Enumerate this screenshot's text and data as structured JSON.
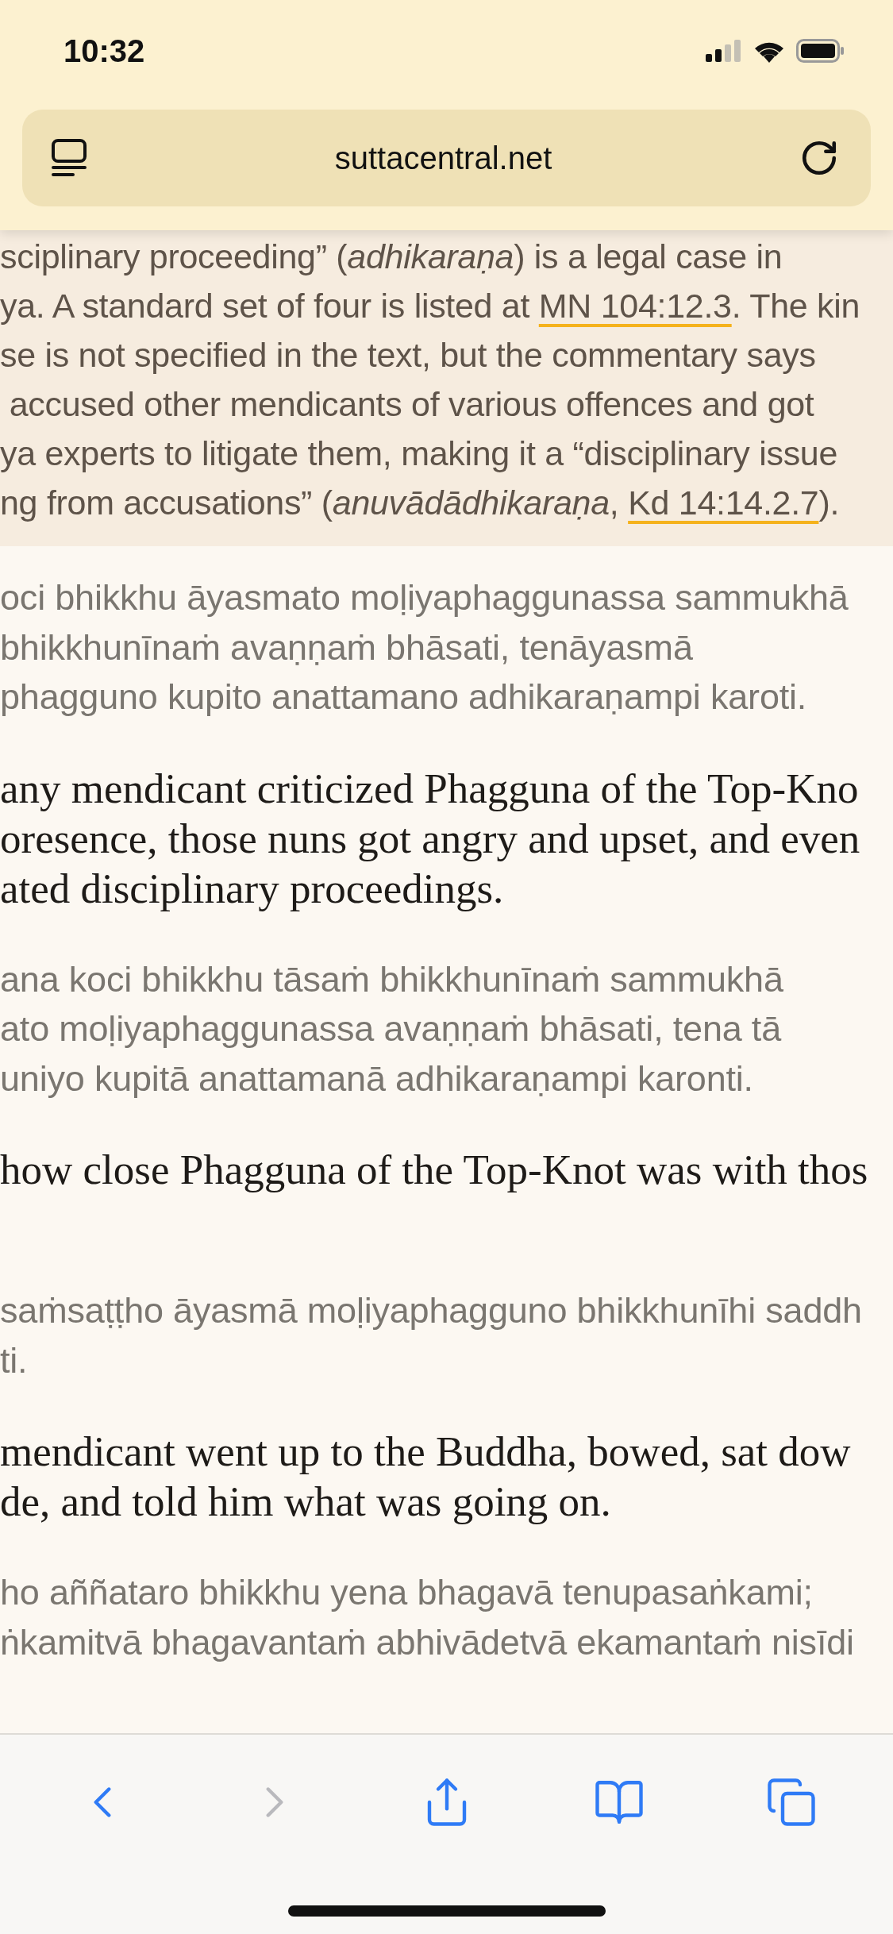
{
  "status_bar": {
    "time": "10:32"
  },
  "address_bar": {
    "url": "suttacentral.net"
  },
  "note": {
    "lines": [
      [
        {
          "kind": "text",
          "text": "sciplinary proceeding” (*adhikaraṇa*) is a legal case in"
        }
      ],
      [
        {
          "kind": "text",
          "text": "ya. A standard set of four is listed at "
        },
        {
          "kind": "link",
          "text": "MN 104:12.3"
        },
        {
          "kind": "text",
          "text": ". The kin"
        }
      ],
      [
        {
          "kind": "text",
          "text": "se is not specified in the text, but the commentary says"
        }
      ],
      [
        {
          "kind": "text",
          "text": " accused other mendicants of various offences and got"
        }
      ],
      [
        {
          "kind": "text",
          "text": "ya experts to litigate them, making it a “disciplinary issue"
        }
      ],
      [
        {
          "kind": "text",
          "text": "ng from accusations” (*anuvādādhikaraṇa*, "
        },
        {
          "kind": "link",
          "text": "Kd 14:14.2.7"
        },
        {
          "kind": "text",
          "text": ")."
        }
      ]
    ]
  },
  "passages": [
    {
      "kind": "pali",
      "lines": [
        "oci bhikkhu āyasmato moḷiyaphaggunassa sammukhā",
        "bhikkhunīnaṁ avaṇṇaṁ bhāsati, tenāyasmā",
        "phagguno kupito anattamano adhikaraṇampi karoti."
      ]
    },
    {
      "kind": "english",
      "lines": [
        "any mendicant criticized Phagguna of the Top-Kno",
        "oresence, those nuns got angry and upset, and even",
        "ated disciplinary proceedings."
      ]
    },
    {
      "kind": "pali",
      "lines": [
        "ana koci bhikkhu tāsaṁ bhikkhunīnaṁ sammukhā",
        "ato moḷiyaphaggunassa avaṇṇaṁ bhāsati, tena tā",
        "uniyo kupitā anattamanā adhikaraṇampi karonti."
      ]
    },
    {
      "kind": "english",
      "lines": [
        "how close Phagguna of the Top-Knot was with thos"
      ]
    },
    {
      "kind": "pali",
      "lines": [
        "saṁsaṭṭho āyasmā moḷiyaphagguno bhikkhunīhi saddh",
        "ti."
      ]
    },
    {
      "kind": "english",
      "lines": [
        "mendicant went up to the Buddha, bowed, sat dow",
        "de, and told him what was going on."
      ]
    },
    {
      "kind": "pali",
      "lines": [
        "ho aññataro bhikkhu yena bhagavā tenupasaṅkami;",
        "ṅkamitvā bhagavantaṁ abhivādetvā ekamantaṁ nisīdi"
      ]
    }
  ],
  "toolbar": {
    "buttons": [
      {
        "kind": "back",
        "disabled": false
      },
      {
        "kind": "forward",
        "disabled": true
      },
      {
        "kind": "share",
        "disabled": false
      },
      {
        "kind": "bookmarks",
        "disabled": false
      },
      {
        "kind": "tabs",
        "disabled": false
      }
    ]
  }
}
